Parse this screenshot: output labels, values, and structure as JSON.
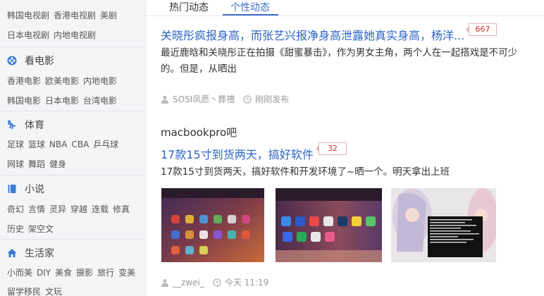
{
  "sidebar": {
    "rows": [
      [
        "韩国电视剧",
        "香港电视剧",
        "美剧"
      ],
      [
        "日本电视剧",
        "内地电视剧"
      ]
    ],
    "sections": [
      {
        "title": "看电影",
        "icon": "film-icon",
        "rows": [
          [
            "香港电影",
            "欧美电影",
            "内地电影"
          ],
          [
            "韩国电影",
            "日本电影",
            "台湾电影"
          ]
        ]
      },
      {
        "title": "体育",
        "icon": "sports-icon",
        "rows": [
          [
            "足球",
            "篮球",
            "NBA",
            "CBA",
            "乒乓球"
          ],
          [
            "网球",
            "舞蹈",
            "健身"
          ]
        ]
      },
      {
        "title": "小说",
        "icon": "book-icon",
        "rows": [
          [
            "奇幻",
            "言情",
            "灵异",
            "穿越",
            "连载",
            "修真"
          ],
          [
            "历史",
            "架空文"
          ]
        ]
      },
      {
        "title": "生活家",
        "icon": "home-icon",
        "rows": [
          [
            "小而美",
            "DIY",
            "美食",
            "摄影",
            "旅行",
            "变美"
          ],
          [
            "留学移民",
            "文玩"
          ]
        ]
      }
    ],
    "accent": "#3d7ad6"
  },
  "tabs": [
    {
      "label": "热门动态",
      "active": false
    },
    {
      "label": "个性动态",
      "active": true
    }
  ],
  "posts": [
    {
      "title": "关晓彤疯报身高，而张艺兴报净身高泄露她真实身高，杨洋...",
      "count": "667",
      "text": "最近鹿晗和关晓彤正在拍摄《甜蜜暴击》，作为男女主角，两个人在一起搭戏是不可少的。但是，从晒出",
      "author": "SOSI凤愿丶葬禮",
      "time": "刚刚发布"
    },
    {
      "forum": "macbookpro吧",
      "title": "17款15寸到货两天，搞好软件",
      "count": "32",
      "text": "17款15寸到货两天，搞好软件和开发环境了~晒一个。明天拿出上班",
      "author": "__zwei_",
      "time": "今天 11:19"
    }
  ]
}
